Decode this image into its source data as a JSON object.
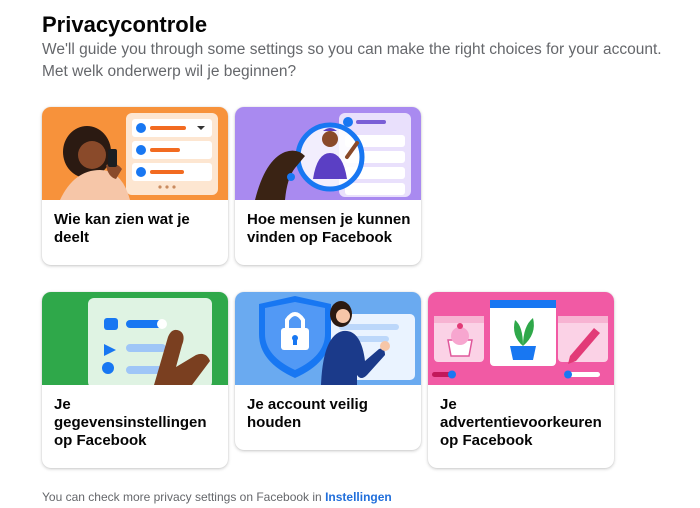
{
  "header": {
    "title": "Privacycontrole",
    "subtitle_line1": "We'll guide you through some settings so you can make the right choices for your account.",
    "subtitle_line2": "Met welk onderwerp wil je beginnen?"
  },
  "cards": [
    {
      "label": "Wie kan zien wat je deelt",
      "illustration": "person-phone-settings-list",
      "bg": "#f7923b"
    },
    {
      "label": "Hoe mensen je kunnen vinden op Facebook",
      "illustration": "magnifier-person-contacts",
      "bg": "#a98af0"
    },
    {
      "label": "Je gegevensinstellingen op Facebook",
      "illustration": "hand-tapping-toggles",
      "bg": "#2fa84a"
    },
    {
      "label": "Je account veilig houden",
      "illustration": "shield-lock-person",
      "bg": "#6aaaf0"
    },
    {
      "label": "Je advertentievoorkeuren op Facebook",
      "illustration": "cupcake-plant-pen-ads",
      "bg": "#f15aa4"
    }
  ],
  "footer": {
    "text": "You can check more privacy settings on Facebook in",
    "link_label": "Instellingen"
  }
}
